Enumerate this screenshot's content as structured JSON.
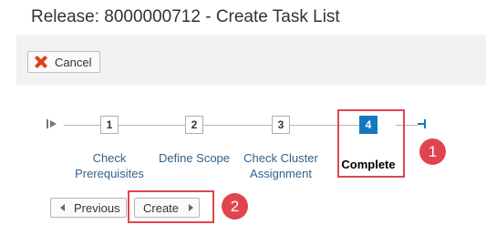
{
  "header": {
    "title": "Release: 8000000712 - Create Task List"
  },
  "toolbar": {
    "cancel_label": "Cancel"
  },
  "wizard": {
    "steps": [
      {
        "number": "1",
        "label_line1": "Check",
        "label_line2": "Prerequisites",
        "state": "completed"
      },
      {
        "number": "2",
        "label_line1": "Define Scope",
        "label_line2": "",
        "state": "completed"
      },
      {
        "number": "3",
        "label_line1": "Check Cluster",
        "label_line2": "Assignment",
        "state": "completed"
      },
      {
        "number": "4",
        "label_line1": "Complete",
        "label_line2": "",
        "state": "current"
      }
    ]
  },
  "navigation": {
    "previous_label": "Previous",
    "create_label": "Create"
  },
  "annotations": {
    "callout_1": "1",
    "callout_2": "2",
    "highlight_color": "#e0454f"
  },
  "colors": {
    "toolbar_bg": "#f2f2f2",
    "active_step": "#1378c0",
    "step_link": "#346187",
    "cancel_icon": "#d9421c"
  }
}
